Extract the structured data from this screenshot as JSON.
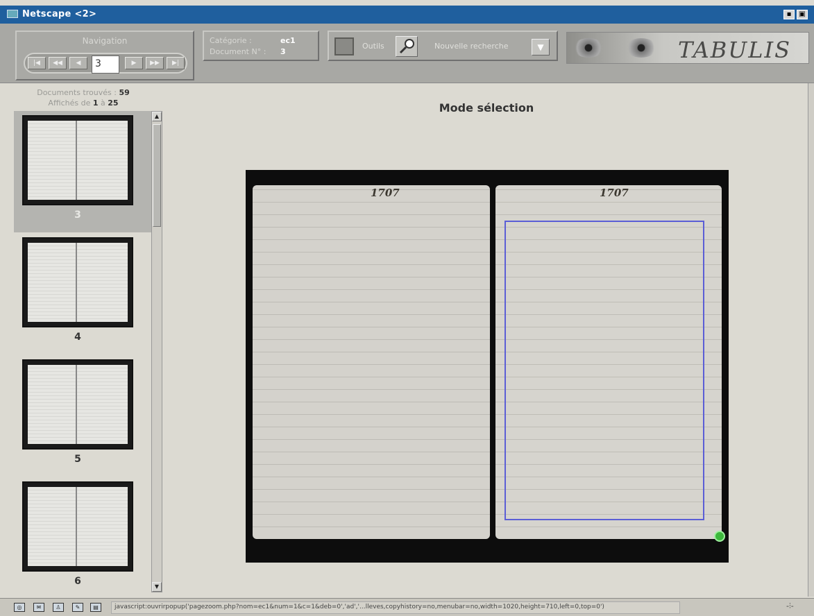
{
  "window": {
    "title": "Netscape <2>",
    "buttons": {
      "minimize": "▪",
      "maximize": "▣"
    }
  },
  "toolbar": {
    "navigation_label": "Navigation",
    "nav_buttons": [
      "|◀",
      "◀◀",
      "◀",
      "▶",
      "▶▶",
      "▶|"
    ],
    "page_input_value": "3",
    "categorie_label": "Catégorie :",
    "categorie_value": "ec1",
    "document_label": "Document N° :",
    "document_value": "3",
    "outils_label": "Outils",
    "nouvelle_recherche_label": "Nouvelle recherche",
    "dropdown_arrow": "▼",
    "logo_text": "TABULIS"
  },
  "results": {
    "documents_trouves_label": "Documents trouvés :",
    "documents_trouves_count": "59",
    "affiches_label": "Affichés de",
    "affiches_from": "1",
    "affiches_to_label": "à",
    "affiches_to": "25"
  },
  "thumbnails": [
    {
      "number": "3",
      "selected": true
    },
    {
      "number": "4",
      "selected": false
    },
    {
      "number": "5",
      "selected": false
    },
    {
      "number": "6",
      "selected": false
    }
  ],
  "viewer": {
    "mode_title": "Mode sélection",
    "year_left": "1707",
    "year_right": "1707"
  },
  "status": {
    "text": "javascript:ouvrirpopup('pagezoom.php?nom=ec1&num=1&c=1&deb=0','ad','...lleves,copyhistory=no,menubar=no,width=1020,height=710,left=0,top=0')"
  },
  "colors": {
    "titlebar": "#1f5f9e",
    "selection_box": "#5b5ed6",
    "ok_button": "#3cb83c"
  }
}
